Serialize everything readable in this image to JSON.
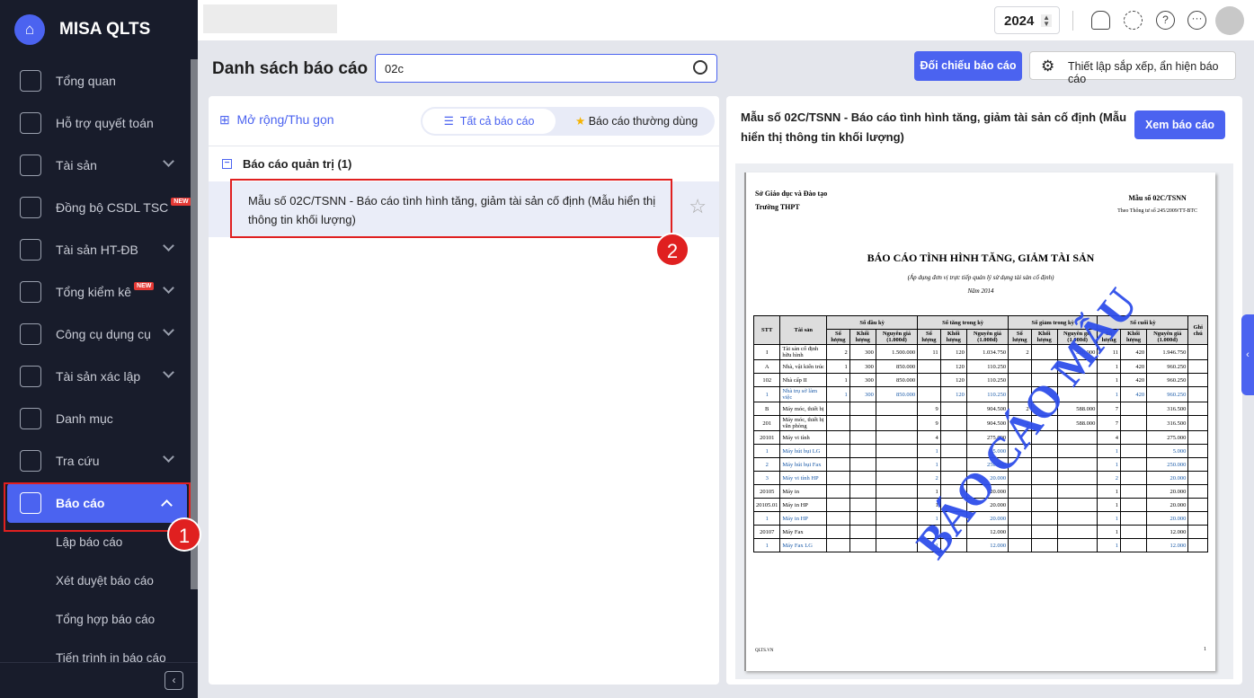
{
  "app": {
    "name": "MISA QLTS"
  },
  "sidebar": {
    "items": [
      {
        "label": "Tổng quan",
        "icon": "monitor-chart-icon"
      },
      {
        "label": "Hỗ trợ quyết toán",
        "icon": "clipboard-check-icon"
      },
      {
        "label": "Tài sản",
        "icon": "house-car-icon",
        "chevron": true
      },
      {
        "label": "Đồng bộ CSDL TSC",
        "icon": "cloud-upload-icon",
        "badge": "NEW"
      },
      {
        "label": "Tài sản HT-ĐB",
        "icon": "road-icon",
        "chevron": true
      },
      {
        "label": "Tổng kiểm kê",
        "icon": "inventory-icon",
        "badge": "NEW",
        "chevron": true
      },
      {
        "label": "Công cụ dụng cụ",
        "icon": "paint-roller-icon",
        "chevron": true
      },
      {
        "label": "Tài sản xác lập",
        "icon": "house-car-icon",
        "chevron": true
      },
      {
        "label": "Danh mục",
        "icon": "list-icon"
      },
      {
        "label": "Tra cứu",
        "icon": "search-icon",
        "chevron": true
      }
    ],
    "active": {
      "label": "Báo cáo",
      "icon": "bar-chart-icon"
    },
    "sub_items": [
      "Lập báo cáo",
      "Xét duyệt báo cáo",
      "Tổng hợp báo cáo",
      "Tiến trình in báo cáo"
    ]
  },
  "annotations": {
    "step1": "1",
    "step2": "2"
  },
  "topbar": {
    "year": "2024"
  },
  "page": {
    "title": "Danh sách báo cáo",
    "search_value": "02c",
    "compare_button": "Đối chiếu báo cáo",
    "settings_button": "Thiết lập sắp xếp, ẩn hiện báo cáo"
  },
  "list": {
    "expand_label": "Mở rộng/Thu gọn",
    "tab_all": "Tất cả báo cáo",
    "tab_favorite": "Báo cáo thường dùng",
    "group": "Báo cáo quản trị (1)",
    "report": "Mẫu số 02C/TSNN - Báo cáo tình hình tăng, giảm tài sản cố định (Mẫu hiển thị thông tin khối lượng)"
  },
  "preview": {
    "title": "Mẫu số 02C/TSNN - Báo cáo tình hình tăng, giảm tài sản cố định (Mẫu hiển thị thông tin khối lượng)",
    "view_button": "Xem báo cáo",
    "paper": {
      "org1": "Sở Giáo dục và Đào tạo",
      "org2": "Trường THPT",
      "form": "Mẫu số 02C/TSNN",
      "circular": "Theo Thông tư số 245/2009/TT-BTC",
      "title": "BÁO CÁO TÌNH HÌNH TĂNG, GIẢM TÀI SẢN",
      "subtitle": "(Áp dụng đơn vị trực tiếp quản lý sử dụng tài sản cố định)",
      "year": "Năm 2014",
      "watermark": "BÁO CÁO MẪU",
      "footer": "QLTS.VN",
      "page": "1",
      "headers": {
        "stt": "STT",
        "asset": "Tài sản",
        "groups": [
          "Số đầu kỳ",
          "Số tăng trong kỳ",
          "Số giảm trong kỳ",
          "Số cuối kỳ"
        ],
        "sub": [
          "Số lượng",
          "Khối lượng",
          "Nguyên giá (1.000đ)"
        ],
        "note": "Ghi chú"
      },
      "rows": [
        [
          "I",
          "Tài sản cố định hữu hình",
          "2",
          "300",
          "1.500.000",
          "11",
          "120",
          "1.034.750",
          "2",
          "",
          "588.000",
          "11",
          "420",
          "1.946.750",
          "",
          0
        ],
        [
          "A",
          "Nhà, vật kiến trúc",
          "1",
          "300",
          "850.000",
          "",
          "120",
          "110.250",
          "",
          "",
          "",
          "1",
          "420",
          "960.250",
          "",
          0
        ],
        [
          "102",
          "Nhà cấp II",
          "1",
          "300",
          "850.000",
          "",
          "120",
          "110.250",
          "",
          "",
          "",
          "1",
          "420",
          "960.250",
          "",
          0
        ],
        [
          "1",
          "Nhà trụ sở làm việc",
          "1",
          "300",
          "850.000",
          "",
          "120",
          "110.250",
          "",
          "",
          "",
          "1",
          "420",
          "960.250",
          "",
          1
        ],
        [
          "B",
          "Máy móc, thiết bị",
          "",
          "",
          "",
          "9",
          "",
          "904.500",
          "2",
          "",
          "588.000",
          "7",
          "",
          "316.500",
          "",
          0
        ],
        [
          "201",
          "Máy móc, thiết bị văn phòng",
          "",
          "",
          "",
          "9",
          "",
          "904.500",
          "2",
          "",
          "588.000",
          "7",
          "",
          "316.500",
          "",
          0
        ],
        [
          "20101",
          "Máy vi tính",
          "",
          "",
          "",
          "4",
          "",
          "275.000",
          "",
          "",
          "",
          "4",
          "",
          "275.000",
          "",
          0
        ],
        [
          "1",
          "Máy hút bụi LG",
          "",
          "",
          "",
          "1",
          "",
          "5.000",
          "",
          "",
          "",
          "1",
          "",
          "5.000",
          "",
          1
        ],
        [
          "2",
          "Máy hút bụi Fax",
          "",
          "",
          "",
          "1",
          "",
          "250.000",
          "",
          "",
          "",
          "1",
          "",
          "250.000",
          "",
          1
        ],
        [
          "3",
          "Máy vi tính HP",
          "",
          "",
          "",
          "2",
          "",
          "20.000",
          "",
          "",
          "",
          "2",
          "",
          "20.000",
          "",
          1
        ],
        [
          "20105",
          "Máy in",
          "",
          "",
          "",
          "1",
          "",
          "20.000",
          "",
          "",
          "",
          "1",
          "",
          "20.000",
          "",
          0
        ],
        [
          "20105.01",
          "Máy in HP",
          "",
          "",
          "",
          "1",
          "",
          "20.000",
          "",
          "",
          "",
          "1",
          "",
          "20.000",
          "",
          0
        ],
        [
          "1",
          "Máy in HP",
          "",
          "",
          "",
          "1",
          "",
          "20.000",
          "",
          "",
          "",
          "1",
          "",
          "20.000",
          "",
          1
        ],
        [
          "20107",
          "Máy Fax",
          "",
          "",
          "",
          "1",
          "",
          "12.000",
          "",
          "",
          "",
          "1",
          "",
          "12.000",
          "",
          0
        ],
        [
          "1",
          "Máy Fax LG",
          "",
          "",
          "",
          "1",
          "",
          "12.000",
          "",
          "",
          "",
          "1",
          "",
          "12.000",
          "",
          1
        ]
      ]
    }
  }
}
